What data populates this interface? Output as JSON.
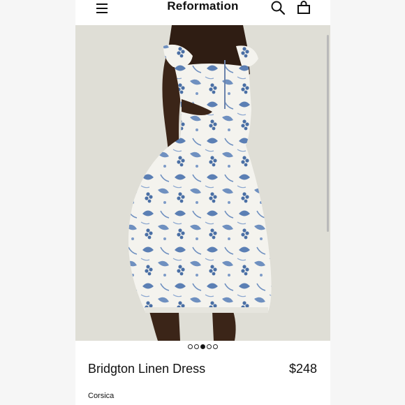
{
  "header": {
    "brand": "Reformation",
    "menu_icon": "hamburger-menu-icon",
    "search_icon": "search-icon",
    "bag_icon": "shopping-bag-icon"
  },
  "gallery": {
    "image_count": 5,
    "active_index": 2
  },
  "product": {
    "name": "Bridgton Linen Dress",
    "price": "$248",
    "color": "Corsica"
  },
  "colors": {
    "text": "#111111",
    "print_blue": "#4a6fa5",
    "dress_base": "#f4f3ee",
    "backdrop": "#dfded6",
    "skin": "#3b2518"
  }
}
